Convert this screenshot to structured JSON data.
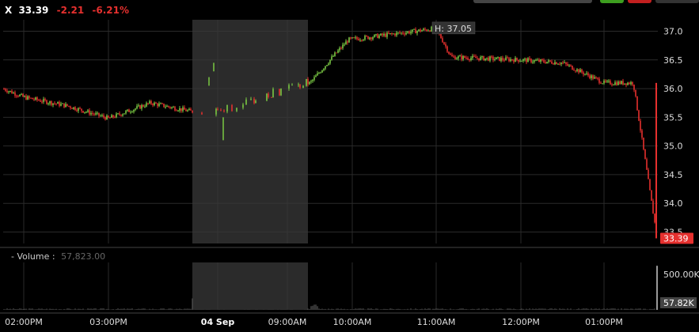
{
  "header": {
    "symbol": "X",
    "last_price": "33.39",
    "change": "-2.21",
    "change_percent": "-6.21%"
  },
  "colors": {
    "up": "#7ac943",
    "down": "#e5302e",
    "grid": "#2a2a2a",
    "premarket_shade": "#3a3a3a",
    "axis_text": "#dddddd",
    "volume": "#555555"
  },
  "volume_panel": {
    "label": "- Volume :",
    "value": "57,823.00",
    "axis_labels": [
      "500.00K",
      "57.82K"
    ]
  },
  "chart_data": {
    "type": "candlestick",
    "title": "",
    "y_ticks": [
      "37.0",
      "36.5",
      "36.0",
      "35.5",
      "35.0",
      "34.5",
      "34.0",
      "33.5"
    ],
    "ylim": [
      33.3,
      37.2
    ],
    "x_ticks": [
      "02:00PM",
      "03:00PM",
      "04 Sep",
      "09:00AM",
      "10:00AM",
      "11:00AM",
      "12:00PM",
      "01:00PM"
    ],
    "session_label": "04 Sep",
    "high_label": "H: 37.05",
    "high_value": 37.05,
    "last_label": "33.39",
    "last_value": 33.39,
    "price_path": [
      {
        "t": "01:30PM-prev",
        "p": 36.0
      },
      {
        "t": "02:00PM",
        "p": 35.85
      },
      {
        "t": "02:30PM",
        "p": 35.7
      },
      {
        "t": "03:00PM",
        "p": 35.48
      },
      {
        "t": "03:30PM",
        "p": 35.75
      },
      {
        "t": "04:00PM",
        "p": 35.6
      },
      {
        "t": "pre-market",
        "p": 35.7
      },
      {
        "t": "09:00AM",
        "p": 36.02
      },
      {
        "t": "09:30AM",
        "p": 36.1
      },
      {
        "t": "10:00AM",
        "p": 36.55
      },
      {
        "t": "10:30AM",
        "p": 36.85
      },
      {
        "t": "11:00AM",
        "p": 37.05
      },
      {
        "t": "11:30AM",
        "p": 36.55
      },
      {
        "t": "12:00PM",
        "p": 36.5
      },
      {
        "t": "12:30PM",
        "p": 36.45
      },
      {
        "t": "01:00PM",
        "p": 36.1
      },
      {
        "t": "01:30PM",
        "p": 36.1
      },
      {
        "t": "close",
        "p": 33.39
      }
    ],
    "volume_spikes": [
      {
        "t": "pre-market",
        "v": 130000
      },
      {
        "t": "10:00AM",
        "v": 75000
      },
      {
        "t": "close",
        "v": 500000
      }
    ]
  }
}
